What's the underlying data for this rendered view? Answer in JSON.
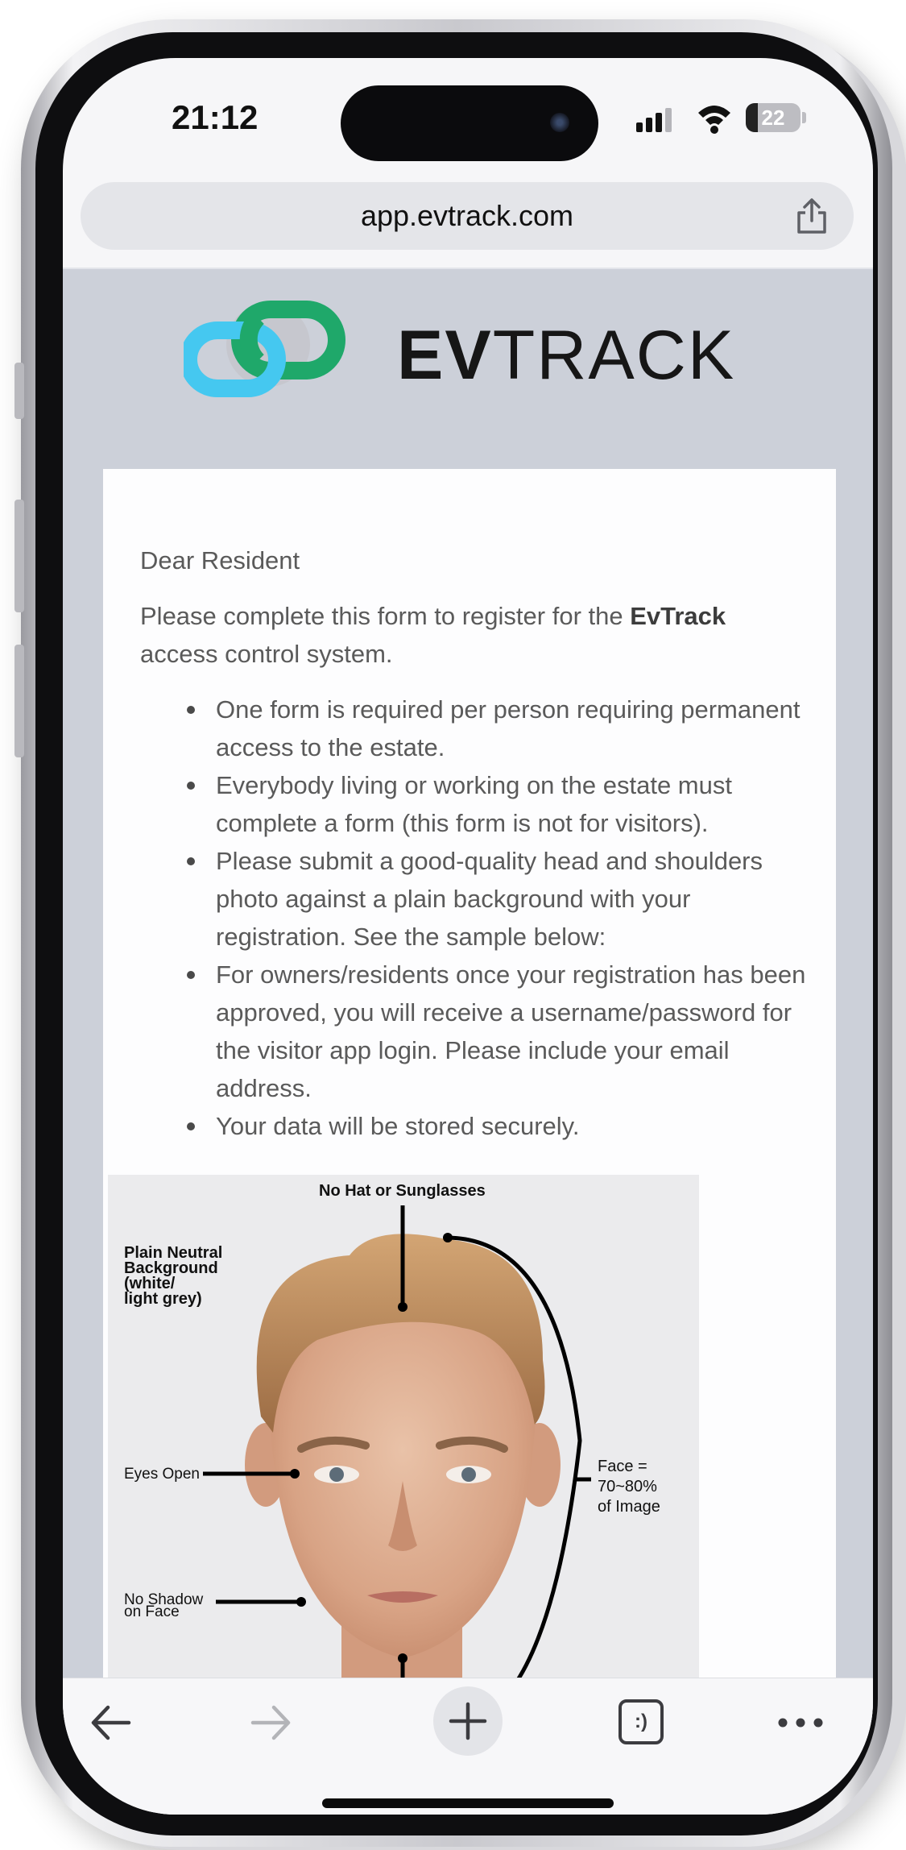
{
  "status_bar": {
    "time": "21:12",
    "battery_level": "22",
    "battery_fraction": 0.22,
    "icons": [
      "signal-icon",
      "wifi-icon",
      "battery-icon"
    ]
  },
  "browser": {
    "url": "app.evtrack.com",
    "share_icon": "share-icon"
  },
  "page": {
    "logo": {
      "wordmark_bold": "EV",
      "wordmark_light": "TRACK",
      "colors": {
        "cyan": "#45c8f0",
        "green": "#1fa86a",
        "grey": "#c4c6cb"
      }
    },
    "greeting": "Dear Resident",
    "intro_before": "Please complete this form to register for the ",
    "intro_brand": "EvTrack",
    "intro_after": " access control system.",
    "notes": [
      "One form is required per person requiring permanent access to the estate.",
      "Everybody living or working on the estate must complete a form (this form is not for visitors).",
      "Please submit a good-quality head and shoulders photo against a plain background with your registration. See the sample below:",
      "For owners/residents once your registration has been approved, you will receive a username/password for the visitor app login. Please include your email address.",
      "Your data will be stored securely."
    ],
    "sample_photo": {
      "label_top": "No Hat or Sunglasses",
      "label_background": [
        "Plain Neutral",
        "Background",
        "(white/",
        "light grey)"
      ],
      "label_eyes": "Eyes Open",
      "label_face": [
        "Face =",
        "70~80%",
        "of Image"
      ],
      "label_shadow": [
        "No Shadow",
        "on Face"
      ]
    }
  },
  "toolbar": {
    "back_icon": "back-arrow-icon",
    "forward_icon": "forward-arrow-icon",
    "new_tab_icon": "plus-icon",
    "tabs_label": ":)",
    "more_icon": "more-icon"
  }
}
